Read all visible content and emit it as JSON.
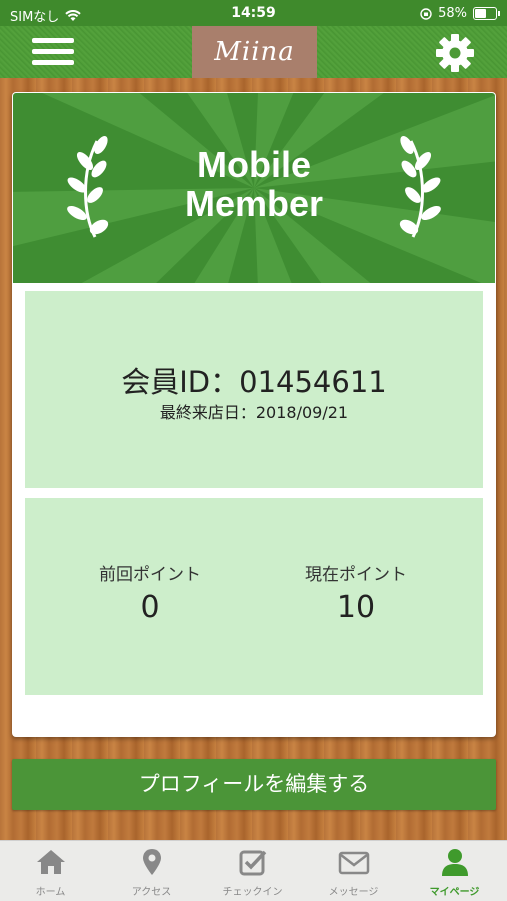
{
  "status_bar": {
    "carrier": "SIMなし",
    "time": "14:59",
    "battery": "58%",
    "battery_level": 0.58
  },
  "header": {
    "logo": "Miina"
  },
  "banner": {
    "title_line1": "Mobile",
    "title_line2": "Member"
  },
  "member": {
    "id_text": "会員ID：01454611",
    "last_visit_text": "最終来店日：2018/09/21"
  },
  "points": {
    "previous_label": "前回ポイント",
    "previous_value": "0",
    "current_label": "現在ポイント",
    "current_value": "10"
  },
  "edit_button": "プロフィールを編集する",
  "tabs": [
    {
      "label": "ホーム",
      "icon": "home-icon"
    },
    {
      "label": "アクセス",
      "icon": "map-pin-icon"
    },
    {
      "label": "チェックイン",
      "icon": "checkin-icon"
    },
    {
      "label": "メッセージ",
      "icon": "envelope-icon"
    },
    {
      "label": "マイページ",
      "icon": "user-icon"
    }
  ],
  "colors": {
    "primary_green": "#4b9538",
    "panel_green": "#cdeecb",
    "active_tab": "#3f9a2c"
  }
}
